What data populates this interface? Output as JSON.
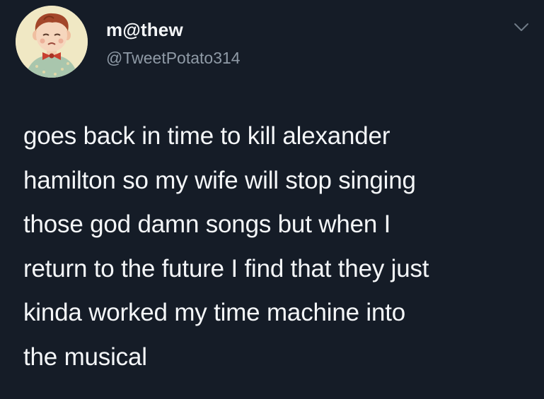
{
  "user": {
    "display_name": "m@thew",
    "handle": "@TweetPotato314",
    "avatar_icon": "avatar-illustration-boy-with-bowtie"
  },
  "menu": {
    "icon": "chevron-down-icon"
  },
  "tweet": {
    "lines": [
      "goes back in time to kill alexander",
      "hamilton so my wife will stop singing",
      "those god damn songs but when I",
      "return to the future I find that they just",
      "kinda worked my time machine into",
      "the musical"
    ]
  },
  "colors": {
    "background": "#151c27",
    "text_primary": "#f4f6f8",
    "text_secondary": "#8f9aa6"
  }
}
